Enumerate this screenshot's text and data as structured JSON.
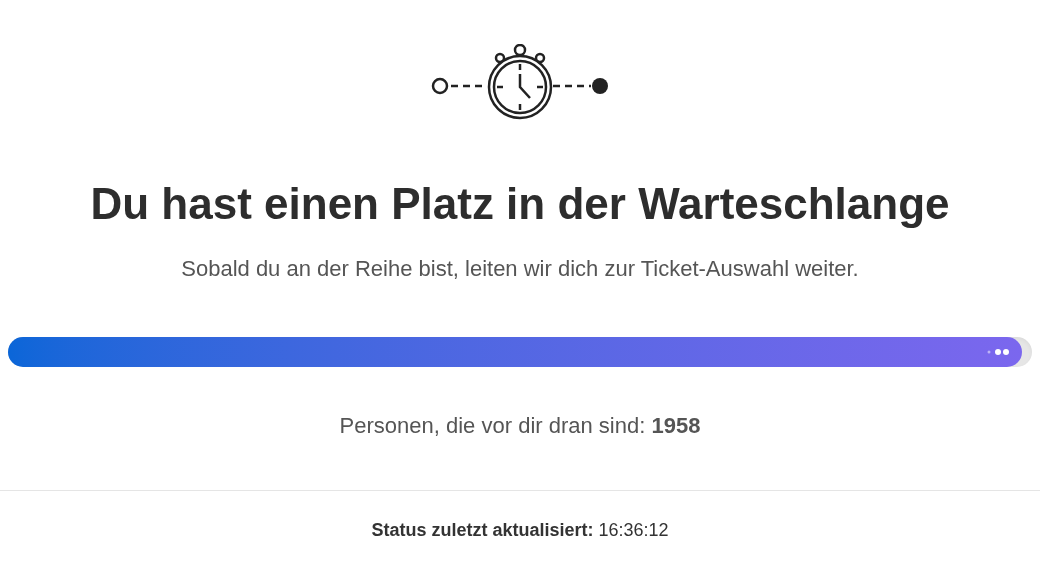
{
  "heading": "Du hast einen Platz in der Warteschlange",
  "subtitle": "Sobald du an der Reihe bist, leiten wir dich zur Ticket-Auswahl weiter.",
  "progress": {
    "level": 0.99
  },
  "queue_count": "Personen, die vor dir dran sind: **1958**",
  "status": "**Status zuletzt aktualisiert:** 16:36:12"
}
